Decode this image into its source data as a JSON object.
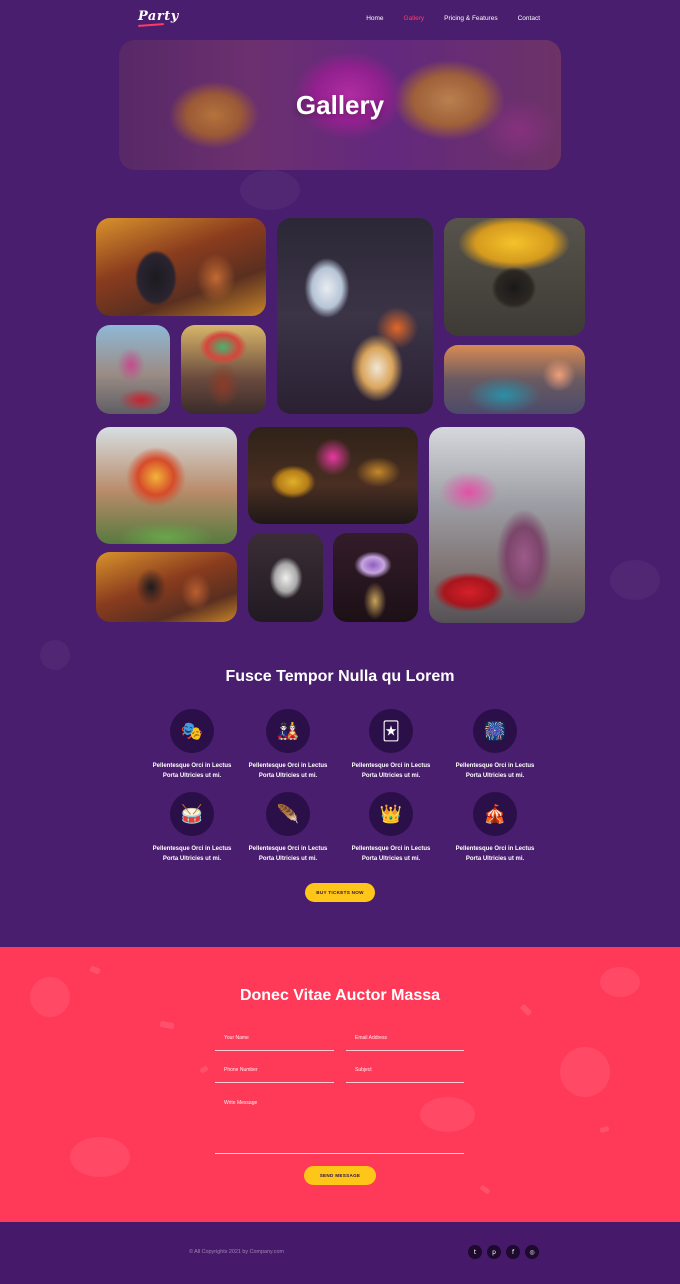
{
  "nav": {
    "logo": "Party",
    "links": [
      "Home",
      "Gallery",
      "Pricing & Features",
      "Contact"
    ],
    "active": "Gallery"
  },
  "hero": {
    "title": "Gallery"
  },
  "features": {
    "title": "Fusce Tempor Nulla qu Lorem",
    "items": [
      {
        "icon": "theater-masks-icon",
        "line1": "Pellentesque Orci in Lectus",
        "line2": "Porta Ultricies ut mi."
      },
      {
        "icon": "party-mask-icon",
        "line1": "Pellentesque Orci in Lectus",
        "line2": "Porta Ultricies ut mi."
      },
      {
        "icon": "jester-mask-icon",
        "line1": "Pellentesque Orci in Lectus",
        "line2": "Porta Ultricies ut mi."
      },
      {
        "icon": "fireworks-icon",
        "line1": "Pellentesque Orci in Lectus",
        "line2": "Porta Ultricies ut mi."
      },
      {
        "icon": "drum-icon",
        "line1": "Pellentesque Orci in Lectus",
        "line2": "Porta Ultricies ut mi."
      },
      {
        "icon": "feather-mask-icon",
        "line1": "Pellentesque Orci in Lectus",
        "line2": "Porta Ultricies ut mi."
      },
      {
        "icon": "king-mask-icon",
        "line1": "Pellentesque Orci in Lectus",
        "line2": "Porta Ultricies ut mi."
      },
      {
        "icon": "circus-tent-icon",
        "line1": "Pellentesque Orci in Lectus",
        "line2": "Porta Ultricies ut mi."
      }
    ],
    "button": "BUY TICKETS NOW"
  },
  "contact": {
    "title": "Donec Vitae Auctor Massa",
    "fields": {
      "name": "Your Name",
      "email": "Email Address",
      "phone": "Phone Number",
      "subject": "Subject",
      "message": "Write Message"
    },
    "button": "SEND MESSAGE"
  },
  "footer": {
    "copyright": "© All Copyrights 2021 by Company.com",
    "socials": [
      "twitter-icon",
      "pinterest-icon",
      "facebook-icon",
      "instagram-icon"
    ]
  },
  "colors": {
    "background": "#4a1e6e",
    "accent_pink": "#ff3a58",
    "accent_yellow": "#ffc61a",
    "nav_active": "#ff3b6b",
    "icon_circle": "#2b0f48"
  }
}
